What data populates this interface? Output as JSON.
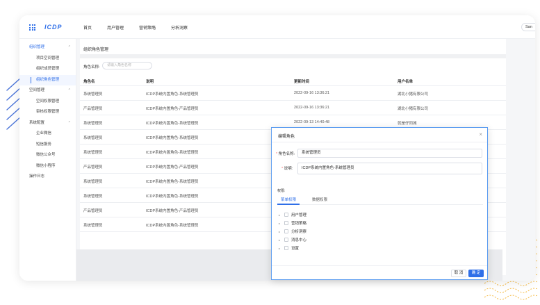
{
  "app": {
    "logo": "ICDP",
    "user_label": "San"
  },
  "nav": {
    "items": [
      "首页",
      "用户管理",
      "营销策略",
      "分析洞察"
    ]
  },
  "sidebar": {
    "items": [
      {
        "label": "组织管理",
        "level": "group",
        "state": "active-group",
        "chev": "^"
      },
      {
        "label": "项目空间管理",
        "level": "sub"
      },
      {
        "label": "组织成员管理",
        "level": "sub"
      },
      {
        "label": "组织角色管理",
        "level": "sub",
        "state": "active"
      },
      {
        "label": "空间管理",
        "level": "group",
        "chev": "^"
      },
      {
        "label": "空间权限管理",
        "level": "sub"
      },
      {
        "label": "审核权限管理",
        "level": "sub"
      },
      {
        "label": "系统配置",
        "level": "group",
        "chev": "^"
      },
      {
        "label": "企业微信",
        "level": "sub"
      },
      {
        "label": "短信服务",
        "level": "sub"
      },
      {
        "label": "微信公众号",
        "level": "sub"
      },
      {
        "label": "微信小程序",
        "level": "sub"
      },
      {
        "label": "操作日志",
        "level": "group"
      }
    ]
  },
  "page": {
    "title": "组织角色管理",
    "search_label": "角色名称:",
    "search_placeholder": "请输入角色名称"
  },
  "table": {
    "columns": [
      "角色名",
      "说明",
      "更新时间",
      "用户名单"
    ],
    "rows": [
      [
        "系统管理员",
        "ICDP系统内置角色-系统管理员",
        "2022-09-16 13:36:21",
        "湖北小猪有限公司"
      ],
      [
        "产品管理员",
        "ICDP系统内置角色-产品管理员",
        "2022-09-16 13:36:21",
        "湖北小猪有限公司"
      ],
      [
        "系统管理员",
        "ICDP系统内置角色-系统管理员",
        "2022-09-13 14:40:48",
        "就是仔同城"
      ],
      [
        "系统管理员",
        "ICDP系统内置角色-系统管理员",
        "",
        ""
      ],
      [
        "系统管理员",
        "ICDP系统内置角色-系统管理员",
        "",
        ""
      ],
      [
        "产品管理员",
        "ICDP系统内置角色-产品管理员",
        "",
        ""
      ],
      [
        "系统管理员",
        "ICDP系统内置角色-系统管理员",
        "",
        ""
      ],
      [
        "系统管理员",
        "ICDP系统内置角色-系统管理员",
        "",
        ""
      ],
      [
        "产品管理员",
        "ICDP系统内置角色-产品管理员",
        "",
        ""
      ],
      [
        "系统管理员",
        "ICDP系统内置角色-系统管理员",
        "",
        ""
      ]
    ]
  },
  "modal": {
    "title": "编辑角色",
    "name_label": "角色名称:",
    "name_value": "系统管理员",
    "desc_label": "说明:",
    "desc_value": "ICDP系统内置角色-系统管理员",
    "perm_label": "权限:",
    "tabs": [
      "菜单权限",
      "数据权限"
    ],
    "tree": [
      "用户管理",
      "营销策略",
      "分析洞察",
      "消息中心",
      "设置"
    ],
    "cancel": "取 消",
    "ok": "确 定"
  },
  "colors": {
    "accent": "#2f6fe8",
    "decor_lines": "#4a74d9",
    "decor_wave": "#f5b942"
  }
}
